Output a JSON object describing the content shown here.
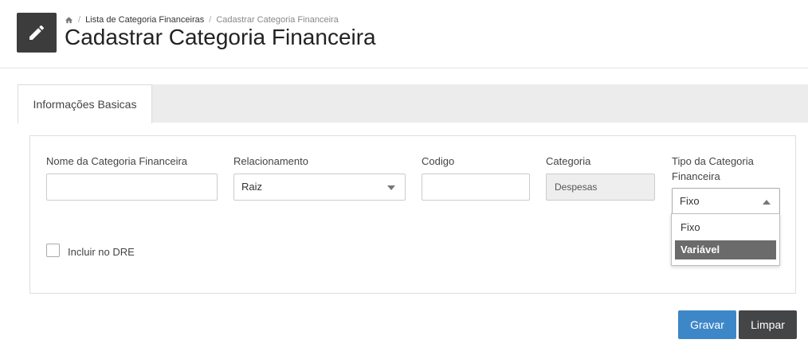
{
  "header": {
    "breadcrumb": {
      "home_icon": "home-icon",
      "items": [
        "Lista de Categoria Financeiras",
        "Cadastrar Categoria Financeira"
      ],
      "separator": "/"
    },
    "title": "Cadastrar Categoria Financeira",
    "page_icon": "pencil-icon"
  },
  "tabs": [
    {
      "label": "Informações Basicas",
      "active": true
    }
  ],
  "form": {
    "nome": {
      "label": "Nome da Categoria Financeira",
      "value": ""
    },
    "relacionamento": {
      "label": "Relacionamento",
      "value": "Raiz"
    },
    "codigo": {
      "label": "Codigo",
      "value": ""
    },
    "categoria": {
      "label": "Categoria",
      "value": "Despesas"
    },
    "tipo": {
      "label_line1": "Tipo da Categoria",
      "label_line2": "Financeira",
      "value": "Fixo",
      "options": [
        "Fixo",
        "Variável"
      ],
      "highlighted": "Variável"
    },
    "incluir_dre": {
      "label": "Incluir no DRE",
      "checked": false
    }
  },
  "actions": {
    "save_label": "Gravar",
    "clear_label": "Limpar"
  },
  "colors": {
    "primary": "#3d87c9",
    "dark": "#444547",
    "icon_bg": "#3c3c3c"
  }
}
